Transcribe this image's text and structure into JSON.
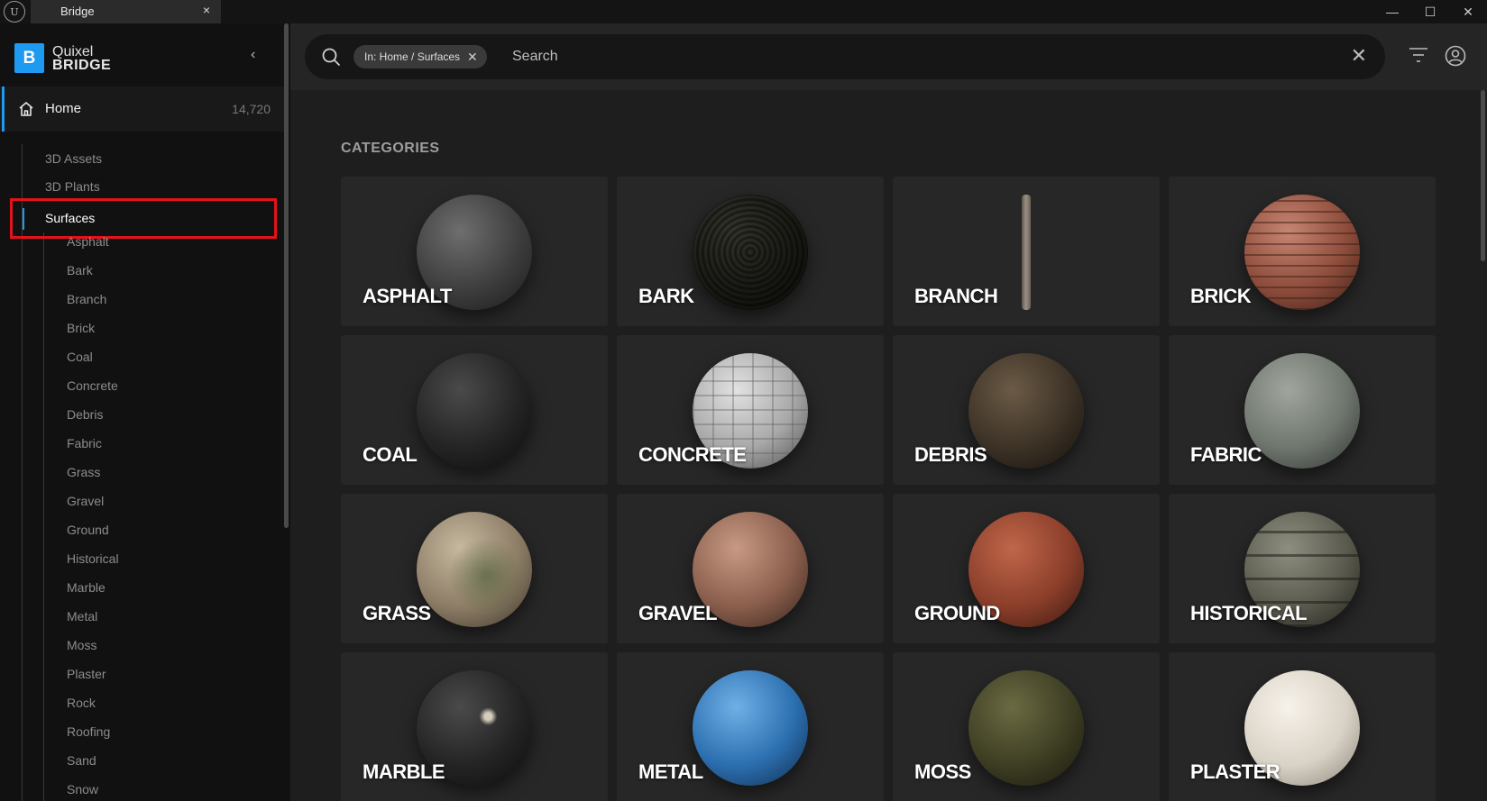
{
  "window": {
    "app_logo_icon": "unreal-engine-icon",
    "tab_title": "Bridge",
    "tab_close": "×",
    "controls": {
      "minimize": "—",
      "maximize": "☐",
      "close": "✕"
    }
  },
  "sidebar": {
    "brand_line1": "Quixel",
    "brand_line2": "BRIDGE",
    "brand_mark": "B",
    "collapse_icon": "‹",
    "home": {
      "label": "Home",
      "count": "14,720"
    },
    "nav": [
      {
        "label": "3D Assets"
      },
      {
        "label": "3D Plants"
      },
      {
        "label": "Surfaces",
        "selected": true
      }
    ],
    "surfaces_children": [
      "Asphalt",
      "Bark",
      "Branch",
      "Brick",
      "Coal",
      "Concrete",
      "Debris",
      "Fabric",
      "Grass",
      "Gravel",
      "Ground",
      "Historical",
      "Marble",
      "Metal",
      "Moss",
      "Plaster",
      "Rock",
      "Roofing",
      "Sand",
      "Snow"
    ]
  },
  "search": {
    "scope_chip": "In: Home / Surfaces",
    "chip_remove": "✕",
    "placeholder": "Search",
    "clear": "✕"
  },
  "main": {
    "section_title": "CATEGORIES",
    "categories": [
      {
        "label": "ASPHALT",
        "material": "asphalt"
      },
      {
        "label": "BARK",
        "material": "bark"
      },
      {
        "label": "BRANCH",
        "material": "branch"
      },
      {
        "label": "BRICK",
        "material": "brick"
      },
      {
        "label": "COAL",
        "material": "coal"
      },
      {
        "label": "CONCRETE",
        "material": "concrete"
      },
      {
        "label": "DEBRIS",
        "material": "debris"
      },
      {
        "label": "FABRIC",
        "material": "fabric"
      },
      {
        "label": "GRASS",
        "material": "grass"
      },
      {
        "label": "GRAVEL",
        "material": "gravel"
      },
      {
        "label": "GROUND",
        "material": "ground"
      },
      {
        "label": "HISTORICAL",
        "material": "historical"
      },
      {
        "label": "MARBLE",
        "material": "marble"
      },
      {
        "label": "METAL",
        "material": "metal"
      },
      {
        "label": "MOSS",
        "material": "moss"
      },
      {
        "label": "PLASTER",
        "material": "plaster"
      }
    ]
  },
  "colors": {
    "accent": "#1e9bf0",
    "highlight_box": "#e3121b",
    "sidebar_bg": "#111111",
    "content_bg": "#1e1e1e",
    "card_bg": "#272727"
  }
}
